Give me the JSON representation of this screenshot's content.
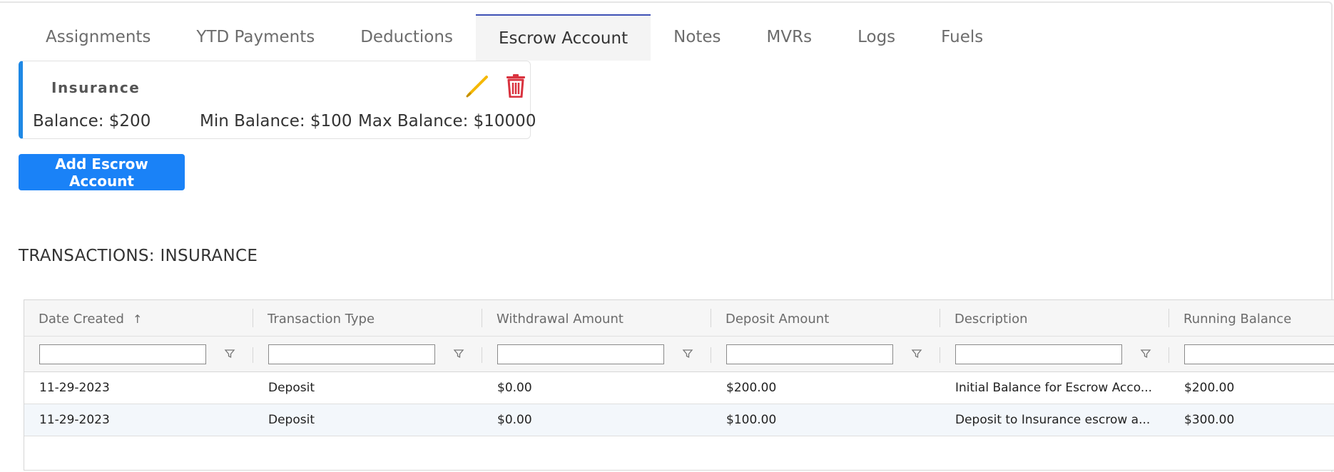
{
  "tabs": [
    {
      "label": "Assignments",
      "active": false
    },
    {
      "label": "YTD Payments",
      "active": false
    },
    {
      "label": "Deductions",
      "active": false
    },
    {
      "label": "Escrow Account",
      "active": true
    },
    {
      "label": "Notes",
      "active": false
    },
    {
      "label": "MVRs",
      "active": false
    },
    {
      "label": "Logs",
      "active": false
    },
    {
      "label": "Fuels",
      "active": false
    }
  ],
  "escrow_card": {
    "title": "Insurance",
    "balance": "Balance: $200",
    "min_balance": "Min Balance: $100",
    "max_balance": "Max Balance: $10000"
  },
  "add_button_label": "Add Escrow Account",
  "transactions_title": "TRANSACTIONS: INSURANCE",
  "grid": {
    "columns": [
      "Date Created",
      "Transaction Type",
      "Withdrawal Amount",
      "Deposit Amount",
      "Description",
      "Running Balance"
    ],
    "sort_indicator": "↑",
    "rows": [
      [
        "11-29-2023",
        "Deposit",
        "$0.00",
        "$200.00",
        "Initial Balance for Escrow Acco...",
        "$200.00"
      ],
      [
        "11-29-2023",
        "Deposit",
        "$0.00",
        "$100.00",
        "Deposit to Insurance escrow a...",
        "$300.00"
      ]
    ]
  },
  "colors": {
    "accent": "#1a82f7",
    "card_border": "#1e88e5",
    "active_tab_border": "#3f51b5",
    "edit_icon": "#f5b800",
    "delete_icon": "#d9333f"
  }
}
